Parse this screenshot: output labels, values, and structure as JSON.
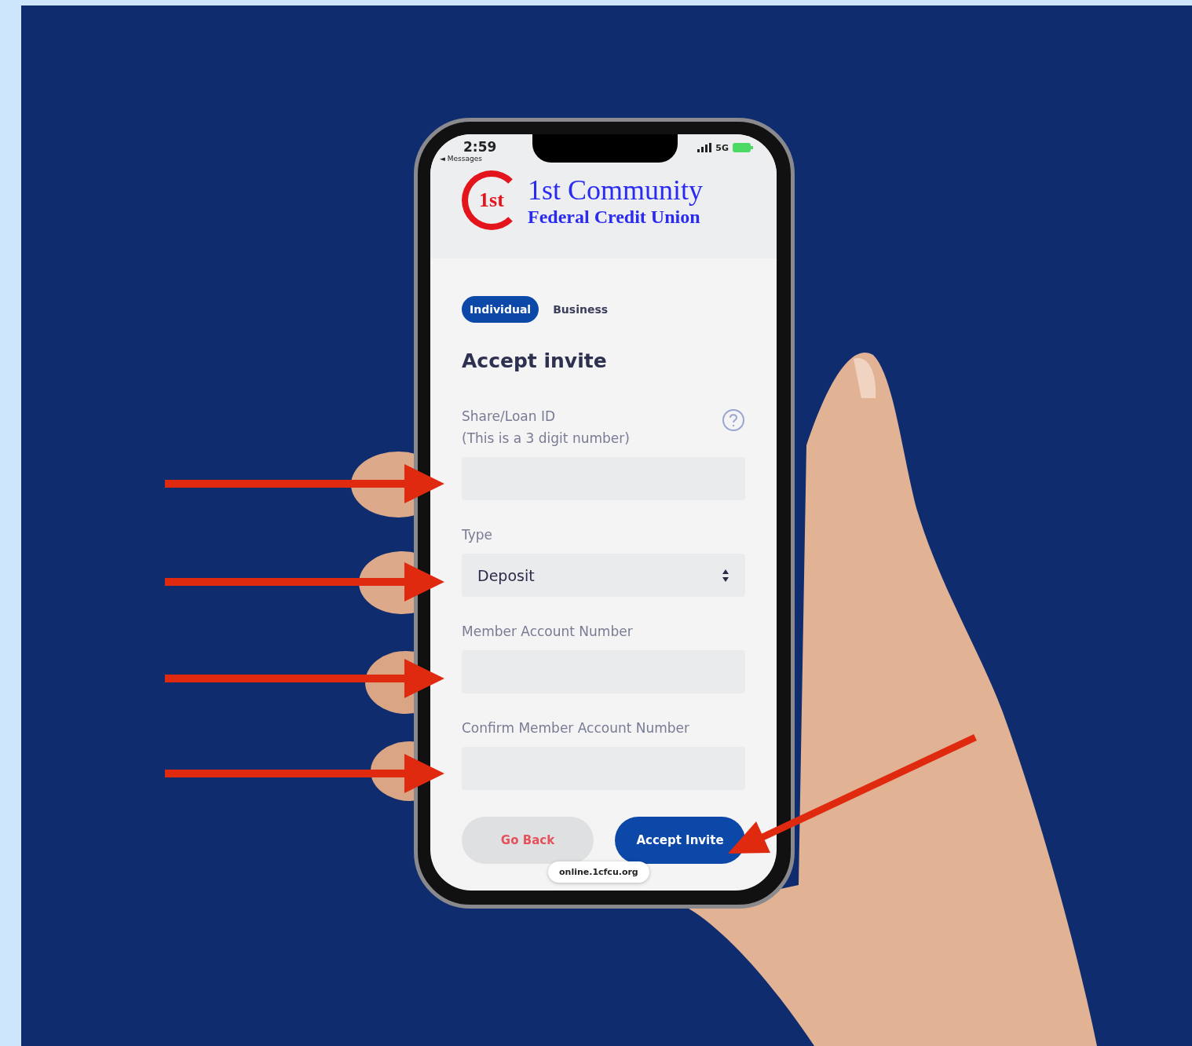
{
  "status_bar": {
    "time": "2:59",
    "back_label": "◄ Messages",
    "network": "5G"
  },
  "logo": {
    "mark": "1st",
    "name": "1st Community",
    "subtitle": "Federal Credit Union"
  },
  "tabs": [
    {
      "label": "Individual",
      "selected": true
    },
    {
      "label": "Business",
      "selected": false
    }
  ],
  "heading": "Accept invite",
  "fields": [
    {
      "kind": "text",
      "label": "Share/Loan ID",
      "hint": "(This is a 3 digit number)",
      "help": true
    },
    {
      "kind": "select",
      "label": "Type",
      "value": "Deposit"
    },
    {
      "kind": "text",
      "label": "Member Account Number"
    },
    {
      "kind": "text",
      "label": "Confirm Member Account Number"
    }
  ],
  "buttons": [
    {
      "kind": "secondary",
      "label": "Go Back"
    },
    {
      "kind": "primary",
      "label": "Accept Invite"
    }
  ],
  "url_bar": "online.1cfcu.org"
}
